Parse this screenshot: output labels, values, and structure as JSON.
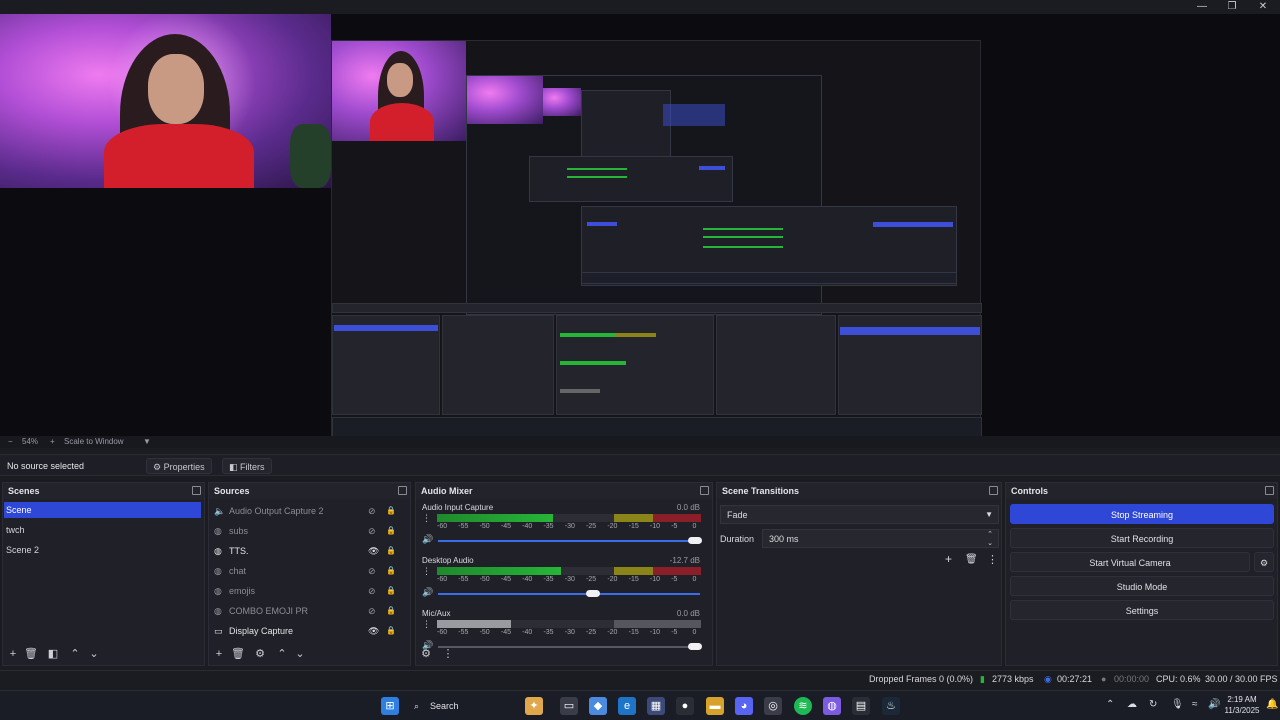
{
  "window_controls": {
    "minimize": "—",
    "maximize": "❐",
    "close": "✕"
  },
  "preview_strip": {
    "zoom": "54%",
    "scale_mode": "Scale to Window"
  },
  "source_toolbar": {
    "no_source": "No source selected",
    "properties": "Properties",
    "filters": "Filters"
  },
  "scenes": {
    "title": "Scenes",
    "items": [
      "Scene",
      "twch",
      "Scene 2"
    ],
    "selected": 0
  },
  "sources": {
    "title": "Sources",
    "items": [
      {
        "label": "Audio Output Capture 2",
        "visible": false,
        "icon": "speaker-icon"
      },
      {
        "label": "subs",
        "visible": false,
        "icon": "globe-icon"
      },
      {
        "label": "TTS.",
        "visible": true,
        "icon": "globe-icon"
      },
      {
        "label": "chat",
        "visible": false,
        "icon": "globe-icon"
      },
      {
        "label": "emojis",
        "visible": false,
        "icon": "globe-icon"
      },
      {
        "label": "COMBO EMOJI PR",
        "visible": false,
        "icon": "globe-icon"
      },
      {
        "label": "Display Capture",
        "visible": true,
        "icon": "monitor-icon"
      }
    ]
  },
  "audio_mixer": {
    "title": "Audio Mixer",
    "ticks": [
      "-60",
      "-55",
      "-50",
      "-45",
      "-40",
      "-35",
      "-30",
      "-25",
      "-20",
      "-15",
      "-10",
      "-5",
      "0"
    ],
    "channels": [
      {
        "name": "Audio Input Capture",
        "db": "0.0 dB",
        "level": 0.44,
        "volume": 1.0,
        "muted": false
      },
      {
        "name": "Desktop Audio",
        "db": "-12.7 dB",
        "level": 0.47,
        "volume": 0.59,
        "muted": false
      },
      {
        "name": "Mic/Aux",
        "db": "0.0 dB",
        "level": 0.28,
        "volume": 1.0,
        "muted": true
      }
    ]
  },
  "scene_transitions": {
    "title": "Scene Transitions",
    "transition": "Fade",
    "duration_label": "Duration",
    "duration_value": "300 ms"
  },
  "controls": {
    "title": "Controls",
    "buttons": [
      "Stop Streaming",
      "Start Recording",
      "Start Virtual Camera",
      "Studio Mode",
      "Settings"
    ]
  },
  "status": {
    "dropped": "Dropped Frames 0 (0.0%)",
    "bitrate": "2773 kbps",
    "stream_time": "00:27:21",
    "rec_time": "00:00:00",
    "cpu": "CPU: 0.6%",
    "fps": "30.00 / 30.00 FPS"
  },
  "taskbar": {
    "search": "Search",
    "time": "2:19 AM",
    "date": "11/3/2025"
  },
  "colors": {
    "accent": "#2f47d6",
    "meter_green": "#27b538",
    "meter_yellow": "#8a8419",
    "meter_red": "#8a1f2a"
  }
}
